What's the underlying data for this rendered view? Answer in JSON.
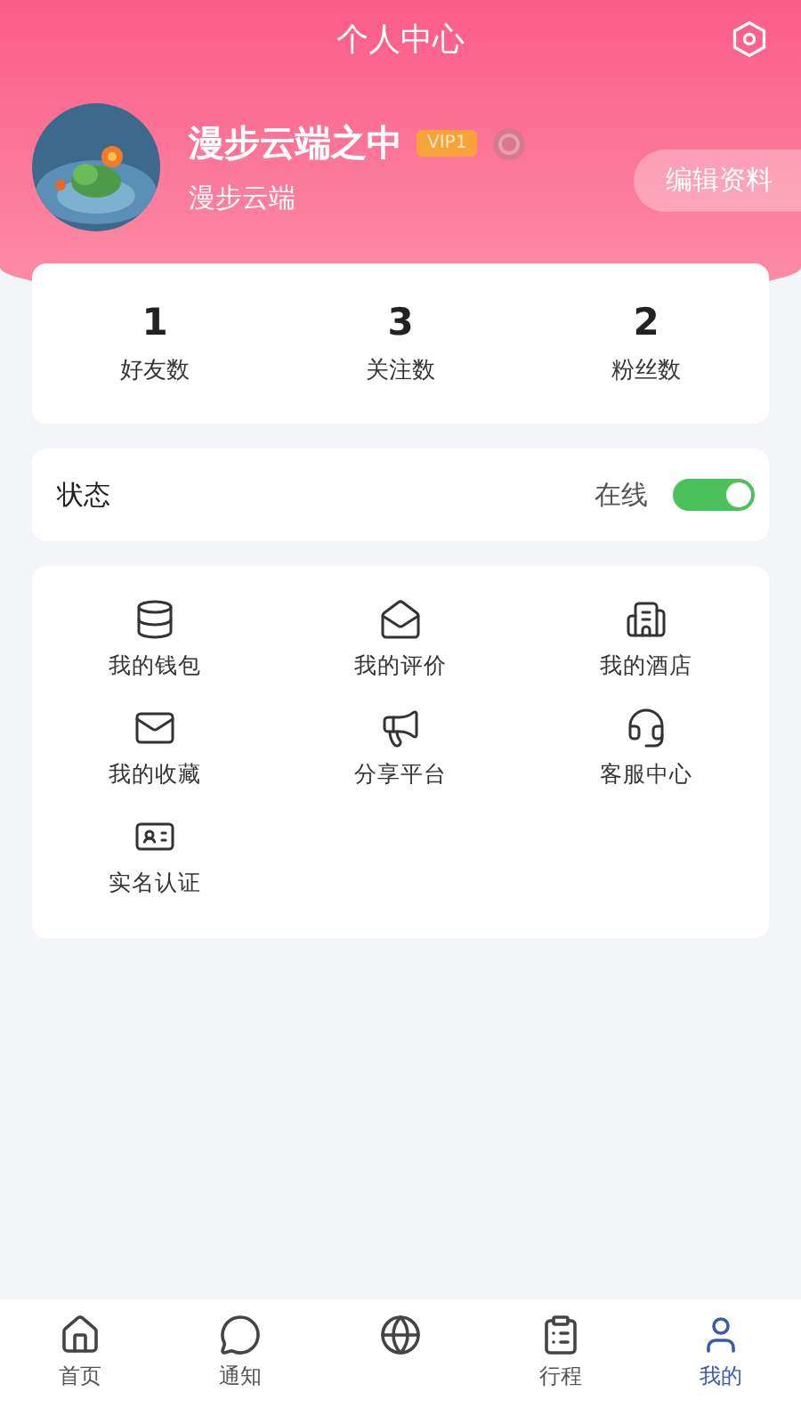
{
  "header": {
    "title": "个人中心"
  },
  "profile": {
    "name": "漫步云端之中",
    "vip": "VIP1",
    "nickname": "漫步云端",
    "edit_button": "编辑资料"
  },
  "stats": [
    {
      "value": "1",
      "label": "好友数"
    },
    {
      "value": "3",
      "label": "关注数"
    },
    {
      "value": "2",
      "label": "粉丝数"
    }
  ],
  "status": {
    "label": "状态",
    "value": "在线",
    "on": true
  },
  "menu": [
    {
      "kind": "wallet",
      "label": "我的钱包"
    },
    {
      "kind": "review",
      "label": "我的评价"
    },
    {
      "kind": "hotel",
      "label": "我的酒店"
    },
    {
      "kind": "favorite",
      "label": "我的收藏"
    },
    {
      "kind": "share",
      "label": "分享平台"
    },
    {
      "kind": "service",
      "label": "客服中心"
    },
    {
      "kind": "idcard",
      "label": "实名认证"
    }
  ],
  "tab_bar": [
    {
      "kind": "home",
      "label": "首页",
      "selected": false
    },
    {
      "kind": "notice",
      "label": "通知",
      "selected": false
    },
    {
      "kind": "globe",
      "selected": false
    },
    {
      "kind": "trip",
      "label": "行程",
      "selected": false
    },
    {
      "kind": "me",
      "label": "我的",
      "selected": true
    }
  ]
}
